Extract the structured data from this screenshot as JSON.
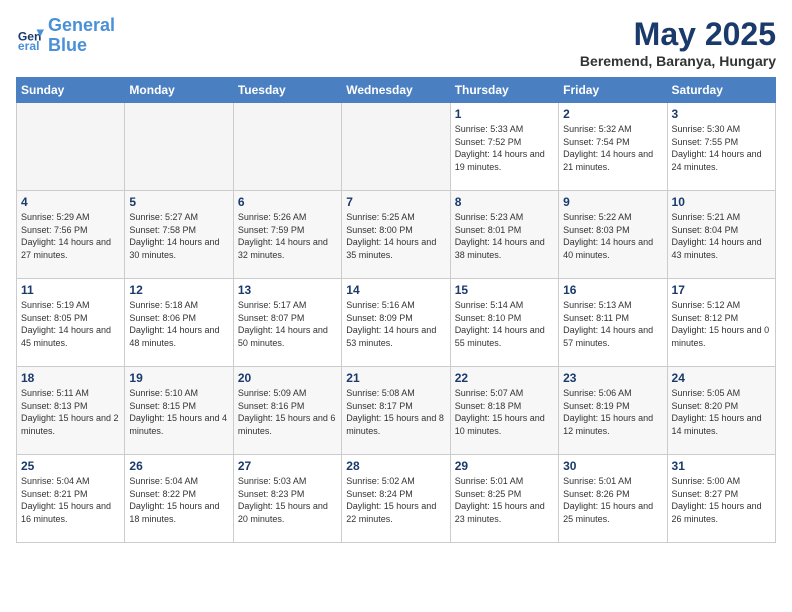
{
  "logo": {
    "line1": "General",
    "line2": "Blue"
  },
  "title": "May 2025",
  "location": "Beremend, Baranya, Hungary",
  "days_of_week": [
    "Sunday",
    "Monday",
    "Tuesday",
    "Wednesday",
    "Thursday",
    "Friday",
    "Saturday"
  ],
  "weeks": [
    [
      {
        "num": "",
        "empty": true
      },
      {
        "num": "",
        "empty": true
      },
      {
        "num": "",
        "empty": true
      },
      {
        "num": "",
        "empty": true
      },
      {
        "num": "1",
        "sunrise": "5:33 AM",
        "sunset": "7:52 PM",
        "daylight": "14 hours and 19 minutes."
      },
      {
        "num": "2",
        "sunrise": "5:32 AM",
        "sunset": "7:54 PM",
        "daylight": "14 hours and 21 minutes."
      },
      {
        "num": "3",
        "sunrise": "5:30 AM",
        "sunset": "7:55 PM",
        "daylight": "14 hours and 24 minutes."
      }
    ],
    [
      {
        "num": "4",
        "sunrise": "5:29 AM",
        "sunset": "7:56 PM",
        "daylight": "14 hours and 27 minutes."
      },
      {
        "num": "5",
        "sunrise": "5:27 AM",
        "sunset": "7:58 PM",
        "daylight": "14 hours and 30 minutes."
      },
      {
        "num": "6",
        "sunrise": "5:26 AM",
        "sunset": "7:59 PM",
        "daylight": "14 hours and 32 minutes."
      },
      {
        "num": "7",
        "sunrise": "5:25 AM",
        "sunset": "8:00 PM",
        "daylight": "14 hours and 35 minutes."
      },
      {
        "num": "8",
        "sunrise": "5:23 AM",
        "sunset": "8:01 PM",
        "daylight": "14 hours and 38 minutes."
      },
      {
        "num": "9",
        "sunrise": "5:22 AM",
        "sunset": "8:03 PM",
        "daylight": "14 hours and 40 minutes."
      },
      {
        "num": "10",
        "sunrise": "5:21 AM",
        "sunset": "8:04 PM",
        "daylight": "14 hours and 43 minutes."
      }
    ],
    [
      {
        "num": "11",
        "sunrise": "5:19 AM",
        "sunset": "8:05 PM",
        "daylight": "14 hours and 45 minutes."
      },
      {
        "num": "12",
        "sunrise": "5:18 AM",
        "sunset": "8:06 PM",
        "daylight": "14 hours and 48 minutes."
      },
      {
        "num": "13",
        "sunrise": "5:17 AM",
        "sunset": "8:07 PM",
        "daylight": "14 hours and 50 minutes."
      },
      {
        "num": "14",
        "sunrise": "5:16 AM",
        "sunset": "8:09 PM",
        "daylight": "14 hours and 53 minutes."
      },
      {
        "num": "15",
        "sunrise": "5:14 AM",
        "sunset": "8:10 PM",
        "daylight": "14 hours and 55 minutes."
      },
      {
        "num": "16",
        "sunrise": "5:13 AM",
        "sunset": "8:11 PM",
        "daylight": "14 hours and 57 minutes."
      },
      {
        "num": "17",
        "sunrise": "5:12 AM",
        "sunset": "8:12 PM",
        "daylight": "15 hours and 0 minutes."
      }
    ],
    [
      {
        "num": "18",
        "sunrise": "5:11 AM",
        "sunset": "8:13 PM",
        "daylight": "15 hours and 2 minutes."
      },
      {
        "num": "19",
        "sunrise": "5:10 AM",
        "sunset": "8:15 PM",
        "daylight": "15 hours and 4 minutes."
      },
      {
        "num": "20",
        "sunrise": "5:09 AM",
        "sunset": "8:16 PM",
        "daylight": "15 hours and 6 minutes."
      },
      {
        "num": "21",
        "sunrise": "5:08 AM",
        "sunset": "8:17 PM",
        "daylight": "15 hours and 8 minutes."
      },
      {
        "num": "22",
        "sunrise": "5:07 AM",
        "sunset": "8:18 PM",
        "daylight": "15 hours and 10 minutes."
      },
      {
        "num": "23",
        "sunrise": "5:06 AM",
        "sunset": "8:19 PM",
        "daylight": "15 hours and 12 minutes."
      },
      {
        "num": "24",
        "sunrise": "5:05 AM",
        "sunset": "8:20 PM",
        "daylight": "15 hours and 14 minutes."
      }
    ],
    [
      {
        "num": "25",
        "sunrise": "5:04 AM",
        "sunset": "8:21 PM",
        "daylight": "15 hours and 16 minutes."
      },
      {
        "num": "26",
        "sunrise": "5:04 AM",
        "sunset": "8:22 PM",
        "daylight": "15 hours and 18 minutes."
      },
      {
        "num": "27",
        "sunrise": "5:03 AM",
        "sunset": "8:23 PM",
        "daylight": "15 hours and 20 minutes."
      },
      {
        "num": "28",
        "sunrise": "5:02 AM",
        "sunset": "8:24 PM",
        "daylight": "15 hours and 22 minutes."
      },
      {
        "num": "29",
        "sunrise": "5:01 AM",
        "sunset": "8:25 PM",
        "daylight": "15 hours and 23 minutes."
      },
      {
        "num": "30",
        "sunrise": "5:01 AM",
        "sunset": "8:26 PM",
        "daylight": "15 hours and 25 minutes."
      },
      {
        "num": "31",
        "sunrise": "5:00 AM",
        "sunset": "8:27 PM",
        "daylight": "15 hours and 26 minutes."
      }
    ]
  ]
}
